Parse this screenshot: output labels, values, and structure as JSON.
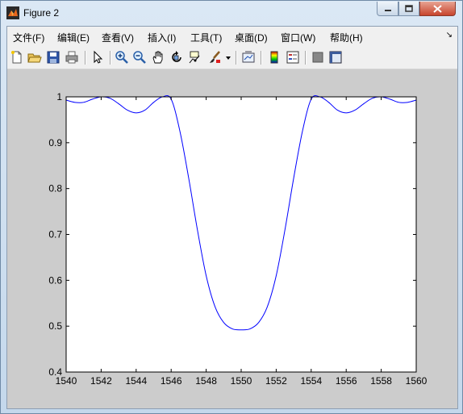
{
  "window": {
    "title": "Figure 2"
  },
  "menu": [
    "文件(F)",
    "编辑(E)",
    "查看(V)",
    "插入(I)",
    "工具(T)",
    "桌面(D)",
    "窗口(W)",
    "帮助(H)"
  ],
  "menu_corner": "↘",
  "toolbar": [
    "new-figure-icon",
    "open-file-icon",
    "save-icon",
    "print-icon",
    "pointer-icon",
    "zoom-in-icon",
    "zoom-out-icon",
    "pan-icon",
    "rotate-3d-icon",
    "data-cursor-icon",
    "brush-icon",
    "link-plot-icon",
    "colorbar-icon",
    "legend-icon",
    "hide-plot-tools-icon",
    "show-plot-tools-icon"
  ],
  "colors": {
    "line": "#0000ff",
    "figure_bg": "#cccccc",
    "axes_bg": "#ffffff"
  },
  "chart_data": {
    "type": "line",
    "xlim": [
      1540,
      1560
    ],
    "ylim": [
      0.4,
      1.0
    ],
    "xticks": [
      1540,
      1542,
      1544,
      1546,
      1548,
      1550,
      1552,
      1554,
      1556,
      1558,
      1560
    ],
    "yticks": [
      0.4,
      0.5,
      0.6,
      0.7,
      0.8,
      0.9,
      1.0
    ],
    "xtick_labels": [
      "1540",
      "1542",
      "1544",
      "1546",
      "1548",
      "1550",
      "1552",
      "1554",
      "1556",
      "1558",
      "1560"
    ],
    "ytick_labels": [
      "0.4",
      "0.5",
      "0.6",
      "0.7",
      "0.8",
      "0.9",
      "1"
    ],
    "grid": false,
    "series": [
      {
        "color": "#0000ff",
        "x": [
          1540,
          1540.5,
          1541,
          1541.5,
          1542,
          1542.5,
          1543,
          1543.5,
          1544,
          1544.5,
          1545,
          1545.5,
          1546,
          1546.5,
          1547,
          1547.5,
          1548,
          1548.5,
          1549,
          1549.5,
          1550,
          1550.5,
          1551,
          1551.5,
          1552,
          1552.5,
          1553,
          1553.5,
          1554,
          1554.5,
          1555,
          1555.5,
          1556,
          1556.5,
          1557,
          1557.5,
          1558,
          1558.5,
          1559,
          1559.5,
          1560
        ],
        "y": [
          0.993,
          0.988,
          0.988,
          0.995,
          1.0,
          0.997,
          0.985,
          0.971,
          0.965,
          0.971,
          0.988,
          1.0,
          0.995,
          0.925,
          0.823,
          0.71,
          0.61,
          0.543,
          0.508,
          0.494,
          0.492,
          0.494,
          0.508,
          0.543,
          0.61,
          0.71,
          0.823,
          0.925,
          0.995,
          1.0,
          0.988,
          0.971,
          0.965,
          0.971,
          0.985,
          0.997,
          1.0,
          0.995,
          0.988,
          0.988,
          0.993
        ]
      }
    ]
  }
}
